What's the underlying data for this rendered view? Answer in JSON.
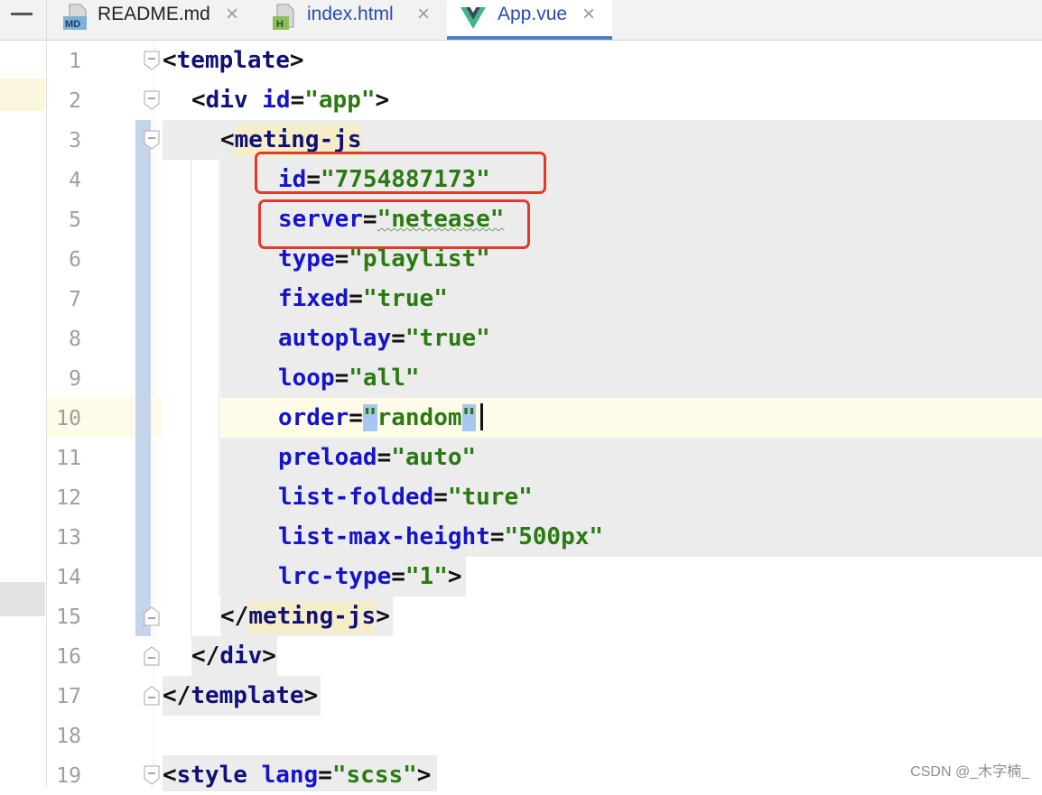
{
  "tabs": [
    {
      "label": "README.md",
      "icon": "markdown-file-icon",
      "icon_text": "MD",
      "active": false
    },
    {
      "label": "index.html",
      "icon": "html-file-icon",
      "icon_text": "H",
      "active": false
    },
    {
      "label": "App.vue",
      "icon": "vue-file-icon",
      "active": true
    }
  ],
  "close_glyph": "×",
  "colors": {
    "tag": "#101078",
    "attribute": "#1414c8",
    "value": "#2a7a12",
    "highlight_box": "#e03b2a",
    "active_tab_underline": "#4a7fc9"
  },
  "lines": [
    {
      "n": "1"
    },
    {
      "n": "2"
    },
    {
      "n": "3"
    },
    {
      "n": "4"
    },
    {
      "n": "5"
    },
    {
      "n": "6"
    },
    {
      "n": "7"
    },
    {
      "n": "8"
    },
    {
      "n": "9"
    },
    {
      "n": "10"
    },
    {
      "n": "11"
    },
    {
      "n": "12"
    },
    {
      "n": "13"
    },
    {
      "n": "14"
    },
    {
      "n": "15"
    },
    {
      "n": "16"
    },
    {
      "n": "17"
    },
    {
      "n": "18"
    },
    {
      "n": "19"
    }
  ],
  "code": {
    "template_tag": "template",
    "div_tag": "div",
    "div_id_attr": "id",
    "div_id_val": "\"app\"",
    "meting_tag": "meting-js",
    "attrs": [
      {
        "name": "id",
        "value": "\"7754887173\""
      },
      {
        "name": "server",
        "value": "\"netease\""
      },
      {
        "name": "type",
        "value": "\"playlist\""
      },
      {
        "name": "fixed",
        "value": "\"true\""
      },
      {
        "name": "autoplay",
        "value": "\"true\""
      },
      {
        "name": "loop",
        "value": "\"all\""
      },
      {
        "name": "order",
        "value": "random"
      },
      {
        "name": "preload",
        "value": "\"auto\""
      },
      {
        "name": "list-folded",
        "value": "\"ture\""
      },
      {
        "name": "list-max-height",
        "value": "\"500px\""
      },
      {
        "name": "lrc-type",
        "value": "\"1\""
      }
    ],
    "style_tag": "style",
    "style_lang_attr": "lang",
    "style_lang_val": "\"scss\""
  },
  "watermark": "CSDN @_木字楠_"
}
